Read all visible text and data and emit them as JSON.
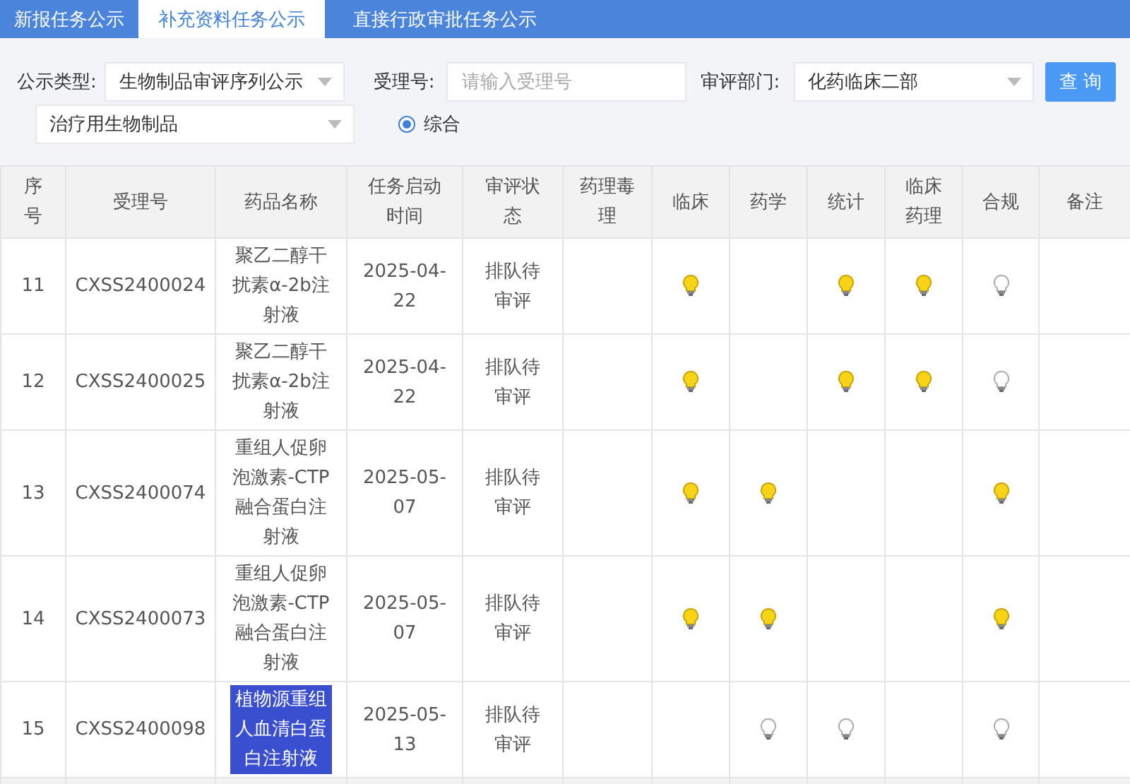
{
  "tabs": [
    {
      "label": "新报任务公示",
      "selected": false
    },
    {
      "label": "补充资料任务公示",
      "selected": true
    },
    {
      "label": "直接行政审批任务公示",
      "selected": false
    }
  ],
  "filters": {
    "type_label": "公示类型:",
    "type_value": "生物制品审评序列公示",
    "number_label": "受理号:",
    "number_placeholder": "请输入受理号",
    "dept_label": "审评部门:",
    "dept_value": "化药临床二部",
    "subtype_value": "治疗用生物制品",
    "radio": {
      "label": "综合",
      "selected": true
    },
    "query_button": "查 询"
  },
  "table": {
    "columns": [
      "序号",
      "受理号",
      "药品名称",
      "任务启动时间",
      "审评状态",
      "药理毒理",
      "临床",
      "药学",
      "统计",
      "临床药理",
      "合规",
      "备注"
    ],
    "rows": [
      {
        "index": "11",
        "number": "CXSS2400024",
        "name": "聚乙二醇干扰素α-2b注射液",
        "name_selected": false,
        "date": "2025-04-22",
        "status": "排队待审评",
        "lamps": [
          {
            "shown": false
          },
          {
            "shown": true,
            "on": true
          },
          {
            "shown": false
          },
          {
            "shown": true,
            "on": true
          },
          {
            "shown": true,
            "on": true
          },
          {
            "shown": true,
            "on": false
          }
        ]
      },
      {
        "index": "12",
        "number": "CXSS2400025",
        "name": "聚乙二醇干扰素α-2b注射液",
        "name_selected": false,
        "date": "2025-04-22",
        "status": "排队待审评",
        "lamps": [
          {
            "shown": false
          },
          {
            "shown": true,
            "on": true
          },
          {
            "shown": false
          },
          {
            "shown": true,
            "on": true
          },
          {
            "shown": true,
            "on": true
          },
          {
            "shown": true,
            "on": false
          }
        ]
      },
      {
        "index": "13",
        "number": "CXSS2400074",
        "name": "重组人促卵泡激素-CTP融合蛋白注射液",
        "name_selected": false,
        "date": "2025-05-07",
        "status": "排队待审评",
        "lamps": [
          {
            "shown": false
          },
          {
            "shown": true,
            "on": true
          },
          {
            "shown": true,
            "on": true
          },
          {
            "shown": false
          },
          {
            "shown": false
          },
          {
            "shown": true,
            "on": true
          }
        ]
      },
      {
        "index": "14",
        "number": "CXSS2400073",
        "name": "重组人促卵泡激素-CTP融合蛋白注射液",
        "name_selected": false,
        "date": "2025-05-07",
        "status": "排队待审评",
        "lamps": [
          {
            "shown": false
          },
          {
            "shown": true,
            "on": true
          },
          {
            "shown": true,
            "on": true
          },
          {
            "shown": false
          },
          {
            "shown": false
          },
          {
            "shown": true,
            "on": true
          }
        ]
      },
      {
        "index": "15",
        "number": "CXSS2400098",
        "name": "植物源重组人血清白蛋白注射液",
        "name_selected": true,
        "date": "2025-05-13",
        "status": "排队待审评",
        "lamps": [
          {
            "shown": false
          },
          {
            "shown": false
          },
          {
            "shown": true,
            "on": false
          },
          {
            "shown": true,
            "on": false
          },
          {
            "shown": false
          },
          {
            "shown": true,
            "on": false
          }
        ]
      }
    ]
  }
}
